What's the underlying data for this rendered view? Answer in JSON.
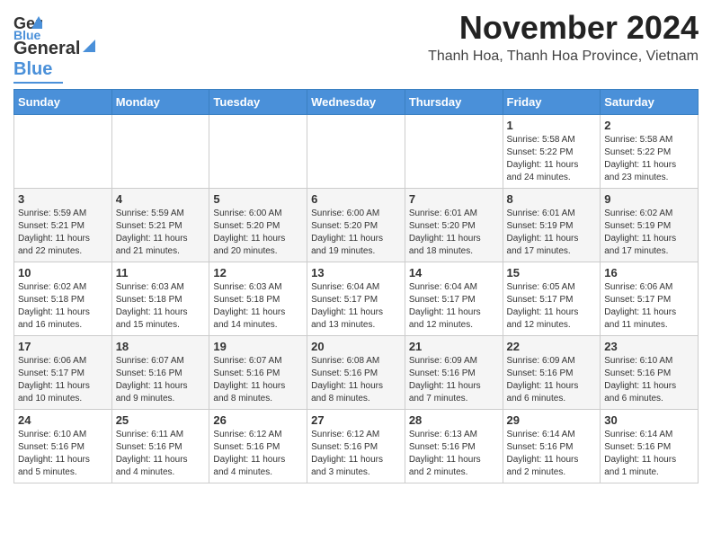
{
  "header": {
    "logo": {
      "line1": "General",
      "line2": "Blue"
    },
    "month": "November 2024",
    "location": "Thanh Hoa, Thanh Hoa Province, Vietnam"
  },
  "weekdays": [
    "Sunday",
    "Monday",
    "Tuesday",
    "Wednesday",
    "Thursday",
    "Friday",
    "Saturday"
  ],
  "weeks": [
    [
      {
        "day": "",
        "info": ""
      },
      {
        "day": "",
        "info": ""
      },
      {
        "day": "",
        "info": ""
      },
      {
        "day": "",
        "info": ""
      },
      {
        "day": "",
        "info": ""
      },
      {
        "day": "1",
        "info": "Sunrise: 5:58 AM\nSunset: 5:22 PM\nDaylight: 11 hours\nand 24 minutes."
      },
      {
        "day": "2",
        "info": "Sunrise: 5:58 AM\nSunset: 5:22 PM\nDaylight: 11 hours\nand 23 minutes."
      }
    ],
    [
      {
        "day": "3",
        "info": "Sunrise: 5:59 AM\nSunset: 5:21 PM\nDaylight: 11 hours\nand 22 minutes."
      },
      {
        "day": "4",
        "info": "Sunrise: 5:59 AM\nSunset: 5:21 PM\nDaylight: 11 hours\nand 21 minutes."
      },
      {
        "day": "5",
        "info": "Sunrise: 6:00 AM\nSunset: 5:20 PM\nDaylight: 11 hours\nand 20 minutes."
      },
      {
        "day": "6",
        "info": "Sunrise: 6:00 AM\nSunset: 5:20 PM\nDaylight: 11 hours\nand 19 minutes."
      },
      {
        "day": "7",
        "info": "Sunrise: 6:01 AM\nSunset: 5:20 PM\nDaylight: 11 hours\nand 18 minutes."
      },
      {
        "day": "8",
        "info": "Sunrise: 6:01 AM\nSunset: 5:19 PM\nDaylight: 11 hours\nand 17 minutes."
      },
      {
        "day": "9",
        "info": "Sunrise: 6:02 AM\nSunset: 5:19 PM\nDaylight: 11 hours\nand 17 minutes."
      }
    ],
    [
      {
        "day": "10",
        "info": "Sunrise: 6:02 AM\nSunset: 5:18 PM\nDaylight: 11 hours\nand 16 minutes."
      },
      {
        "day": "11",
        "info": "Sunrise: 6:03 AM\nSunset: 5:18 PM\nDaylight: 11 hours\nand 15 minutes."
      },
      {
        "day": "12",
        "info": "Sunrise: 6:03 AM\nSunset: 5:18 PM\nDaylight: 11 hours\nand 14 minutes."
      },
      {
        "day": "13",
        "info": "Sunrise: 6:04 AM\nSunset: 5:17 PM\nDaylight: 11 hours\nand 13 minutes."
      },
      {
        "day": "14",
        "info": "Sunrise: 6:04 AM\nSunset: 5:17 PM\nDaylight: 11 hours\nand 12 minutes."
      },
      {
        "day": "15",
        "info": "Sunrise: 6:05 AM\nSunset: 5:17 PM\nDaylight: 11 hours\nand 12 minutes."
      },
      {
        "day": "16",
        "info": "Sunrise: 6:06 AM\nSunset: 5:17 PM\nDaylight: 11 hours\nand 11 minutes."
      }
    ],
    [
      {
        "day": "17",
        "info": "Sunrise: 6:06 AM\nSunset: 5:17 PM\nDaylight: 11 hours\nand 10 minutes."
      },
      {
        "day": "18",
        "info": "Sunrise: 6:07 AM\nSunset: 5:16 PM\nDaylight: 11 hours\nand 9 minutes."
      },
      {
        "day": "19",
        "info": "Sunrise: 6:07 AM\nSunset: 5:16 PM\nDaylight: 11 hours\nand 8 minutes."
      },
      {
        "day": "20",
        "info": "Sunrise: 6:08 AM\nSunset: 5:16 PM\nDaylight: 11 hours\nand 8 minutes."
      },
      {
        "day": "21",
        "info": "Sunrise: 6:09 AM\nSunset: 5:16 PM\nDaylight: 11 hours\nand 7 minutes."
      },
      {
        "day": "22",
        "info": "Sunrise: 6:09 AM\nSunset: 5:16 PM\nDaylight: 11 hours\nand 6 minutes."
      },
      {
        "day": "23",
        "info": "Sunrise: 6:10 AM\nSunset: 5:16 PM\nDaylight: 11 hours\nand 6 minutes."
      }
    ],
    [
      {
        "day": "24",
        "info": "Sunrise: 6:10 AM\nSunset: 5:16 PM\nDaylight: 11 hours\nand 5 minutes."
      },
      {
        "day": "25",
        "info": "Sunrise: 6:11 AM\nSunset: 5:16 PM\nDaylight: 11 hours\nand 4 minutes."
      },
      {
        "day": "26",
        "info": "Sunrise: 6:12 AM\nSunset: 5:16 PM\nDaylight: 11 hours\nand 4 minutes."
      },
      {
        "day": "27",
        "info": "Sunrise: 6:12 AM\nSunset: 5:16 PM\nDaylight: 11 hours\nand 3 minutes."
      },
      {
        "day": "28",
        "info": "Sunrise: 6:13 AM\nSunset: 5:16 PM\nDaylight: 11 hours\nand 2 minutes."
      },
      {
        "day": "29",
        "info": "Sunrise: 6:14 AM\nSunset: 5:16 PM\nDaylight: 11 hours\nand 2 minutes."
      },
      {
        "day": "30",
        "info": "Sunrise: 6:14 AM\nSunset: 5:16 PM\nDaylight: 11 hours\nand 1 minute."
      }
    ]
  ]
}
